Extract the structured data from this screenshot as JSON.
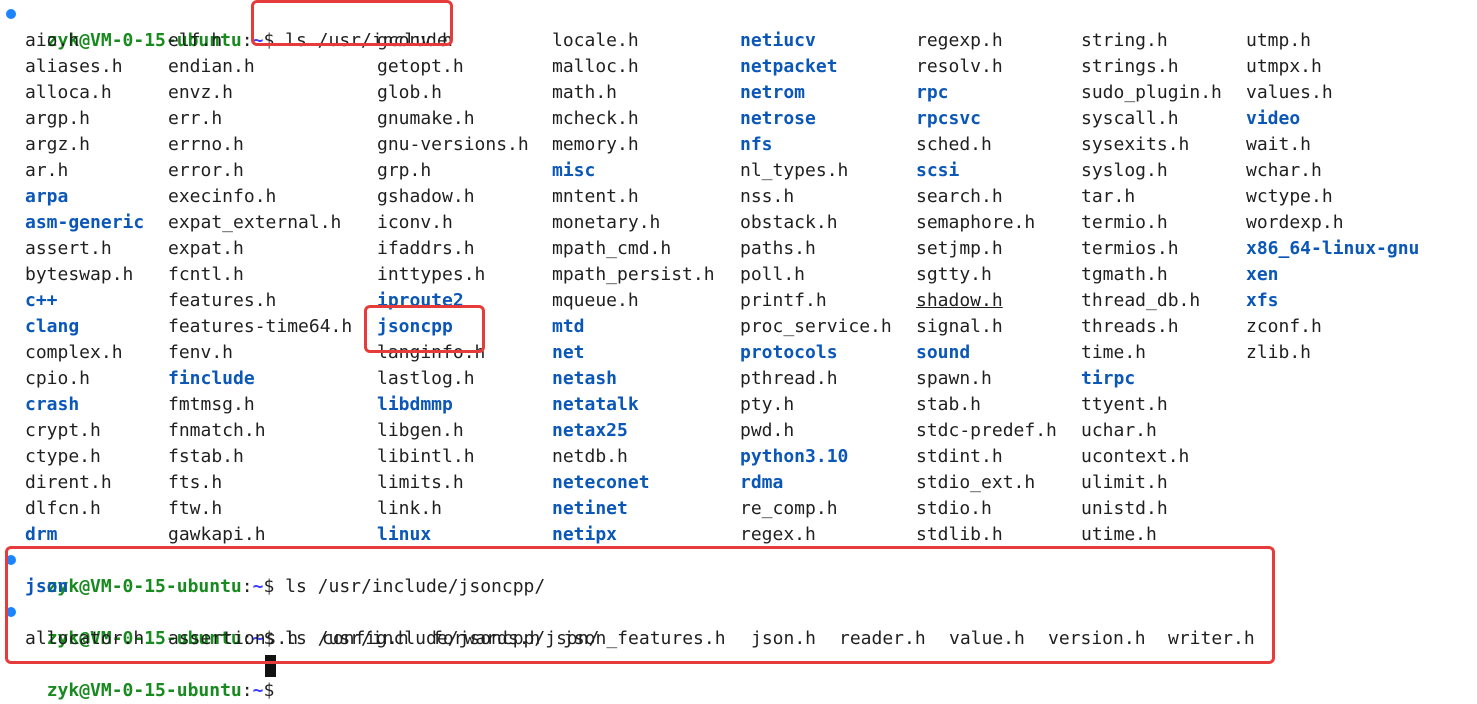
{
  "prompt": {
    "user_host": "zyk@VM-0-15-ubuntu",
    "path": "~",
    "symbol": "$"
  },
  "command1": "ls /usr/include",
  "listing": {
    "columns": [
      [
        {
          "name": "aio.h",
          "dir": false
        },
        {
          "name": "aliases.h",
          "dir": false
        },
        {
          "name": "alloca.h",
          "dir": false
        },
        {
          "name": "argp.h",
          "dir": false
        },
        {
          "name": "argz.h",
          "dir": false
        },
        {
          "name": "ar.h",
          "dir": false
        },
        {
          "name": "arpa",
          "dir": true
        },
        {
          "name": "asm-generic",
          "dir": true
        },
        {
          "name": "assert.h",
          "dir": false
        },
        {
          "name": "byteswap.h",
          "dir": false
        },
        {
          "name": "c++",
          "dir": true
        },
        {
          "name": "clang",
          "dir": true
        },
        {
          "name": "complex.h",
          "dir": false
        },
        {
          "name": "cpio.h",
          "dir": false
        },
        {
          "name": "crash",
          "dir": true
        },
        {
          "name": "crypt.h",
          "dir": false
        },
        {
          "name": "ctype.h",
          "dir": false
        },
        {
          "name": "dirent.h",
          "dir": false
        },
        {
          "name": "dlfcn.h",
          "dir": false
        },
        {
          "name": "drm",
          "dir": true
        }
      ],
      [
        {
          "name": "elf.h",
          "dir": false
        },
        {
          "name": "endian.h",
          "dir": false
        },
        {
          "name": "envz.h",
          "dir": false
        },
        {
          "name": "err.h",
          "dir": false
        },
        {
          "name": "errno.h",
          "dir": false
        },
        {
          "name": "error.h",
          "dir": false
        },
        {
          "name": "execinfo.h",
          "dir": false
        },
        {
          "name": "expat_external.h",
          "dir": false
        },
        {
          "name": "expat.h",
          "dir": false
        },
        {
          "name": "fcntl.h",
          "dir": false
        },
        {
          "name": "features.h",
          "dir": false
        },
        {
          "name": "features-time64.h",
          "dir": false
        },
        {
          "name": "fenv.h",
          "dir": false
        },
        {
          "name": "finclude",
          "dir": true
        },
        {
          "name": "fmtmsg.h",
          "dir": false
        },
        {
          "name": "fnmatch.h",
          "dir": false
        },
        {
          "name": "fstab.h",
          "dir": false
        },
        {
          "name": "fts.h",
          "dir": false
        },
        {
          "name": "ftw.h",
          "dir": false
        },
        {
          "name": "gawkapi.h",
          "dir": false
        }
      ],
      [
        {
          "name": "gconv.h",
          "dir": false
        },
        {
          "name": "getopt.h",
          "dir": false
        },
        {
          "name": "glob.h",
          "dir": false
        },
        {
          "name": "gnumake.h",
          "dir": false
        },
        {
          "name": "gnu-versions.h",
          "dir": false
        },
        {
          "name": "grp.h",
          "dir": false
        },
        {
          "name": "gshadow.h",
          "dir": false
        },
        {
          "name": "iconv.h",
          "dir": false
        },
        {
          "name": "ifaddrs.h",
          "dir": false
        },
        {
          "name": "inttypes.h",
          "dir": false
        },
        {
          "name": "iproute2",
          "dir": true
        },
        {
          "name": "jsoncpp",
          "dir": true
        },
        {
          "name": "langinfo.h",
          "dir": false
        },
        {
          "name": "lastlog.h",
          "dir": false
        },
        {
          "name": "libdmmp",
          "dir": true
        },
        {
          "name": "libgen.h",
          "dir": false
        },
        {
          "name": "libintl.h",
          "dir": false
        },
        {
          "name": "limits.h",
          "dir": false
        },
        {
          "name": "link.h",
          "dir": false
        },
        {
          "name": "linux",
          "dir": true
        }
      ],
      [
        {
          "name": "locale.h",
          "dir": false
        },
        {
          "name": "malloc.h",
          "dir": false
        },
        {
          "name": "math.h",
          "dir": false
        },
        {
          "name": "mcheck.h",
          "dir": false
        },
        {
          "name": "memory.h",
          "dir": false
        },
        {
          "name": "misc",
          "dir": true
        },
        {
          "name": "mntent.h",
          "dir": false
        },
        {
          "name": "monetary.h",
          "dir": false
        },
        {
          "name": "mpath_cmd.h",
          "dir": false
        },
        {
          "name": "mpath_persist.h",
          "dir": false
        },
        {
          "name": "mqueue.h",
          "dir": false
        },
        {
          "name": "mtd",
          "dir": true
        },
        {
          "name": "net",
          "dir": true
        },
        {
          "name": "netash",
          "dir": true
        },
        {
          "name": "netatalk",
          "dir": true
        },
        {
          "name": "netax25",
          "dir": true
        },
        {
          "name": "netdb.h",
          "dir": false
        },
        {
          "name": "neteconet",
          "dir": true
        },
        {
          "name": "netinet",
          "dir": true
        },
        {
          "name": "netipx",
          "dir": true
        }
      ],
      [
        {
          "name": "netiucv",
          "dir": true
        },
        {
          "name": "netpacket",
          "dir": true
        },
        {
          "name": "netrom",
          "dir": true
        },
        {
          "name": "netrose",
          "dir": true
        },
        {
          "name": "nfs",
          "dir": true
        },
        {
          "name": "nl_types.h",
          "dir": false
        },
        {
          "name": "nss.h",
          "dir": false
        },
        {
          "name": "obstack.h",
          "dir": false
        },
        {
          "name": "paths.h",
          "dir": false
        },
        {
          "name": "poll.h",
          "dir": false
        },
        {
          "name": "printf.h",
          "dir": false
        },
        {
          "name": "proc_service.h",
          "dir": false
        },
        {
          "name": "protocols",
          "dir": true
        },
        {
          "name": "pthread.h",
          "dir": false
        },
        {
          "name": "pty.h",
          "dir": false
        },
        {
          "name": "pwd.h",
          "dir": false
        },
        {
          "name": "python3.10",
          "dir": true
        },
        {
          "name": "rdma",
          "dir": true
        },
        {
          "name": "re_comp.h",
          "dir": false
        },
        {
          "name": "regex.h",
          "dir": false
        }
      ],
      [
        {
          "name": "regexp.h",
          "dir": false
        },
        {
          "name": "resolv.h",
          "dir": false
        },
        {
          "name": "rpc",
          "dir": true
        },
        {
          "name": "rpcsvc",
          "dir": true
        },
        {
          "name": "sched.h",
          "dir": false
        },
        {
          "name": "scsi",
          "dir": true
        },
        {
          "name": "search.h",
          "dir": false
        },
        {
          "name": "semaphore.h",
          "dir": false
        },
        {
          "name": "setjmp.h",
          "dir": false
        },
        {
          "name": "sgtty.h",
          "dir": false
        },
        {
          "name": "shadow.h",
          "dir": false,
          "link": true
        },
        {
          "name": "signal.h",
          "dir": false
        },
        {
          "name": "sound",
          "dir": true
        },
        {
          "name": "spawn.h",
          "dir": false
        },
        {
          "name": "stab.h",
          "dir": false
        },
        {
          "name": "stdc-predef.h",
          "dir": false
        },
        {
          "name": "stdint.h",
          "dir": false
        },
        {
          "name": "stdio_ext.h",
          "dir": false
        },
        {
          "name": "stdio.h",
          "dir": false
        },
        {
          "name": "stdlib.h",
          "dir": false
        }
      ],
      [
        {
          "name": "string.h",
          "dir": false
        },
        {
          "name": "strings.h",
          "dir": false
        },
        {
          "name": "sudo_plugin.h",
          "dir": false
        },
        {
          "name": "syscall.h",
          "dir": false
        },
        {
          "name": "sysexits.h",
          "dir": false
        },
        {
          "name": "syslog.h",
          "dir": false
        },
        {
          "name": "tar.h",
          "dir": false
        },
        {
          "name": "termio.h",
          "dir": false
        },
        {
          "name": "termios.h",
          "dir": false
        },
        {
          "name": "tgmath.h",
          "dir": false
        },
        {
          "name": "thread_db.h",
          "dir": false
        },
        {
          "name": "threads.h",
          "dir": false
        },
        {
          "name": "time.h",
          "dir": false
        },
        {
          "name": "tirpc",
          "dir": true
        },
        {
          "name": "ttyent.h",
          "dir": false
        },
        {
          "name": "uchar.h",
          "dir": false
        },
        {
          "name": "ucontext.h",
          "dir": false
        },
        {
          "name": "ulimit.h",
          "dir": false
        },
        {
          "name": "unistd.h",
          "dir": false
        },
        {
          "name": "utime.h",
          "dir": false
        }
      ],
      [
        {
          "name": "utmp.h",
          "dir": false
        },
        {
          "name": "utmpx.h",
          "dir": false
        },
        {
          "name": "values.h",
          "dir": false
        },
        {
          "name": "video",
          "dir": true
        },
        {
          "name": "wait.h",
          "dir": false
        },
        {
          "name": "wchar.h",
          "dir": false
        },
        {
          "name": "wctype.h",
          "dir": false
        },
        {
          "name": "wordexp.h",
          "dir": false
        },
        {
          "name": "x86_64-linux-gnu",
          "dir": true
        },
        {
          "name": "xen",
          "dir": true
        },
        {
          "name": "xfs",
          "dir": true
        },
        {
          "name": "zconf.h",
          "dir": false
        },
        {
          "name": "zlib.h",
          "dir": false
        }
      ]
    ]
  },
  "command2": "ls /usr/include/jsoncpp/",
  "output2": [
    {
      "name": "json",
      "dir": true
    }
  ],
  "command3": "ls /usr/include/jsoncpp/json/",
  "output3": [
    {
      "name": "allocator.h",
      "dir": false
    },
    {
      "name": "assertions.h",
      "dir": false
    },
    {
      "name": "config.h",
      "dir": false
    },
    {
      "name": "forwards.h",
      "dir": false
    },
    {
      "name": "json_features.h",
      "dir": false
    },
    {
      "name": "json.h",
      "dir": false
    },
    {
      "name": "reader.h",
      "dir": false
    },
    {
      "name": "value.h",
      "dir": false
    },
    {
      "name": "version.h",
      "dir": false
    },
    {
      "name": "writer.h",
      "dir": false
    }
  ],
  "colors": {
    "prompt_user": "#188a1f",
    "prompt_path": "#3b3bff",
    "directory": "#0b57b8",
    "highlight": "#e63b3b",
    "status_dot": "#1a85ff"
  }
}
